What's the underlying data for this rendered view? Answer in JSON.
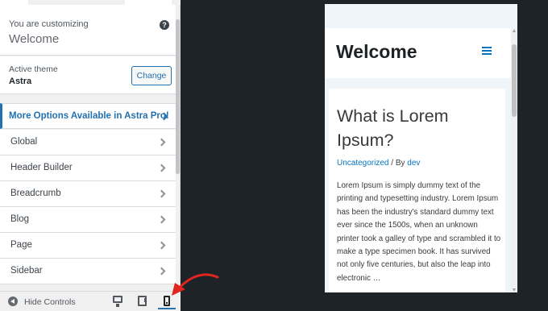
{
  "customizer": {
    "customizing_label": "You are customizing",
    "site_title": "Welcome",
    "help_icon": "help-icon",
    "active_theme_label": "Active theme",
    "theme_name": "Astra",
    "change_label": "Change",
    "pro_banner": "More Options Available in Astra Pro!",
    "sections": [
      {
        "label": "Global"
      },
      {
        "label": "Header Builder"
      },
      {
        "label": "Breadcrumb"
      },
      {
        "label": "Blog"
      },
      {
        "label": "Page"
      },
      {
        "label": "Sidebar"
      }
    ],
    "footer": {
      "hide_controls": "Hide Controls",
      "devices": [
        "desktop",
        "tablet",
        "mobile"
      ],
      "selected_device": "mobile"
    }
  },
  "preview": {
    "site_title": "Welcome",
    "post": {
      "title": "What is Lorem Ipsum?",
      "category": "Uncategorized",
      "meta_sep": " / By ",
      "author": "dev",
      "excerpt": "Lorem Ipsum is simply dummy text of the printing and typesetting industry. Lorem Ipsum has been the industry's standard dummy text ever since the 1500s, when an unknown printer took a galley of type and scrambled it to make a type specimen book. It has survived not only five centuries, but also the leap into electronic …"
    }
  },
  "colors": {
    "accent": "#2271b1",
    "astra_link": "#0274be",
    "annotation_arrow": "#e0261f",
    "backdrop": "#1d2327"
  }
}
